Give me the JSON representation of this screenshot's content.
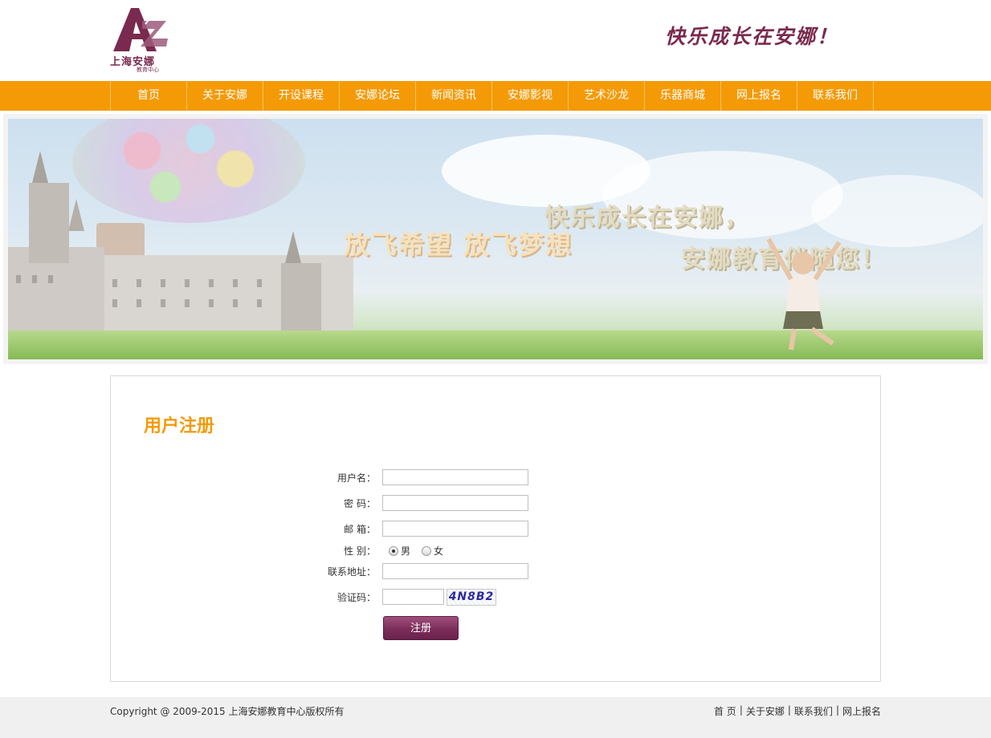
{
  "header": {
    "logo_text": "上海安娜",
    "logo_subtext": "教育中心",
    "slogan": "快乐成长在安娜！"
  },
  "nav": {
    "items": [
      "首页",
      "关于安娜",
      "开设课程",
      "安娜论坛",
      "新闻资讯",
      "安娜影视",
      "艺术沙龙",
      "乐器商城",
      "网上报名",
      "联系我们"
    ]
  },
  "banner": {
    "text1": "放飞希望 放飞梦想",
    "text2": "快乐成长在安娜，",
    "text3": "安娜教育伴随您！"
  },
  "main": {
    "title": "用户注册",
    "form": {
      "username_label": "用户名：",
      "username_value": "",
      "password_label": "密  码：",
      "password_value": "",
      "email_label": "邮  箱：",
      "email_value": "",
      "gender_label": "性  别：",
      "gender_options": [
        "男",
        "女"
      ],
      "gender_selected": "男",
      "address_label": "联系地址：",
      "address_value": "",
      "captcha_label": "验证码：",
      "captcha_value": "",
      "captcha_image_text": "4N8B2",
      "submit_label": "注册"
    }
  },
  "footer": {
    "copyright": "Copyright @ 2009-2015 上海安娜教育中心版权所有",
    "links": [
      "首 页",
      "关于安娜",
      "联系我们",
      "网上报名"
    ]
  },
  "colors": {
    "nav_bg": "#f49a06",
    "brand_purple": "#7a2a4e",
    "title_orange": "#f49a06",
    "footer_bg": "#f0f0f0"
  },
  "icons": {
    "logo": "az-logo-icon",
    "radio": "radio-icon"
  }
}
